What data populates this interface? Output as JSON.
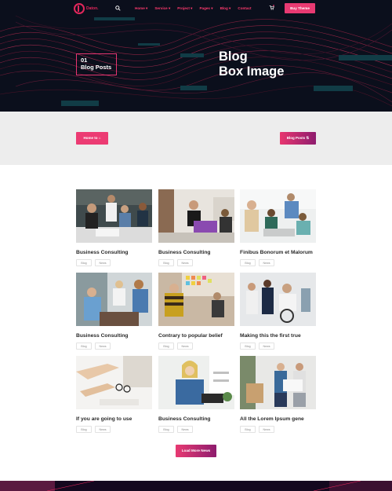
{
  "header": {
    "logo_text": "Daton.",
    "menu": [
      "Home ▾",
      "Service ▾",
      "Project ▾",
      "Pages ▾",
      "Blog ▾",
      "Contact"
    ],
    "buy_label": "Buy Theme"
  },
  "hero": {
    "crumb_number": "01",
    "crumb_title": "Blog Posts",
    "title_line1": "Blog",
    "title_line2": "Box Image"
  },
  "strip": {
    "home_label": "Home to ⌂",
    "posts_label": "Blog Posts ⇅"
  },
  "posts": [
    {
      "title": "Business Consulting",
      "tags": [
        "Blog",
        "News"
      ]
    },
    {
      "title": "Business Consulting",
      "tags": [
        "Blog",
        "News"
      ]
    },
    {
      "title": "Finibus Bonorum et Malorum",
      "tags": [
        "Blog",
        "News"
      ]
    },
    {
      "title": "Business Consulting",
      "tags": [
        "Blog",
        "News"
      ]
    },
    {
      "title": "Contrary to popular belief",
      "tags": [
        "Blog",
        "News"
      ]
    },
    {
      "title": "Making this the first true",
      "tags": [
        "Blog",
        "News"
      ]
    },
    {
      "title": "If you are going to use",
      "tags": [
        "Blog",
        "News"
      ]
    },
    {
      "title": "Business Consulting",
      "tags": [
        "Blog",
        "News"
      ]
    },
    {
      "title": "All the Lorem Ipsum gene",
      "tags": [
        "Blog",
        "News"
      ]
    }
  ],
  "load_more_label": "Load More News",
  "colors": {
    "accent": "#e83a72",
    "dark": "#0b0f1c",
    "teal": "#113c46"
  }
}
